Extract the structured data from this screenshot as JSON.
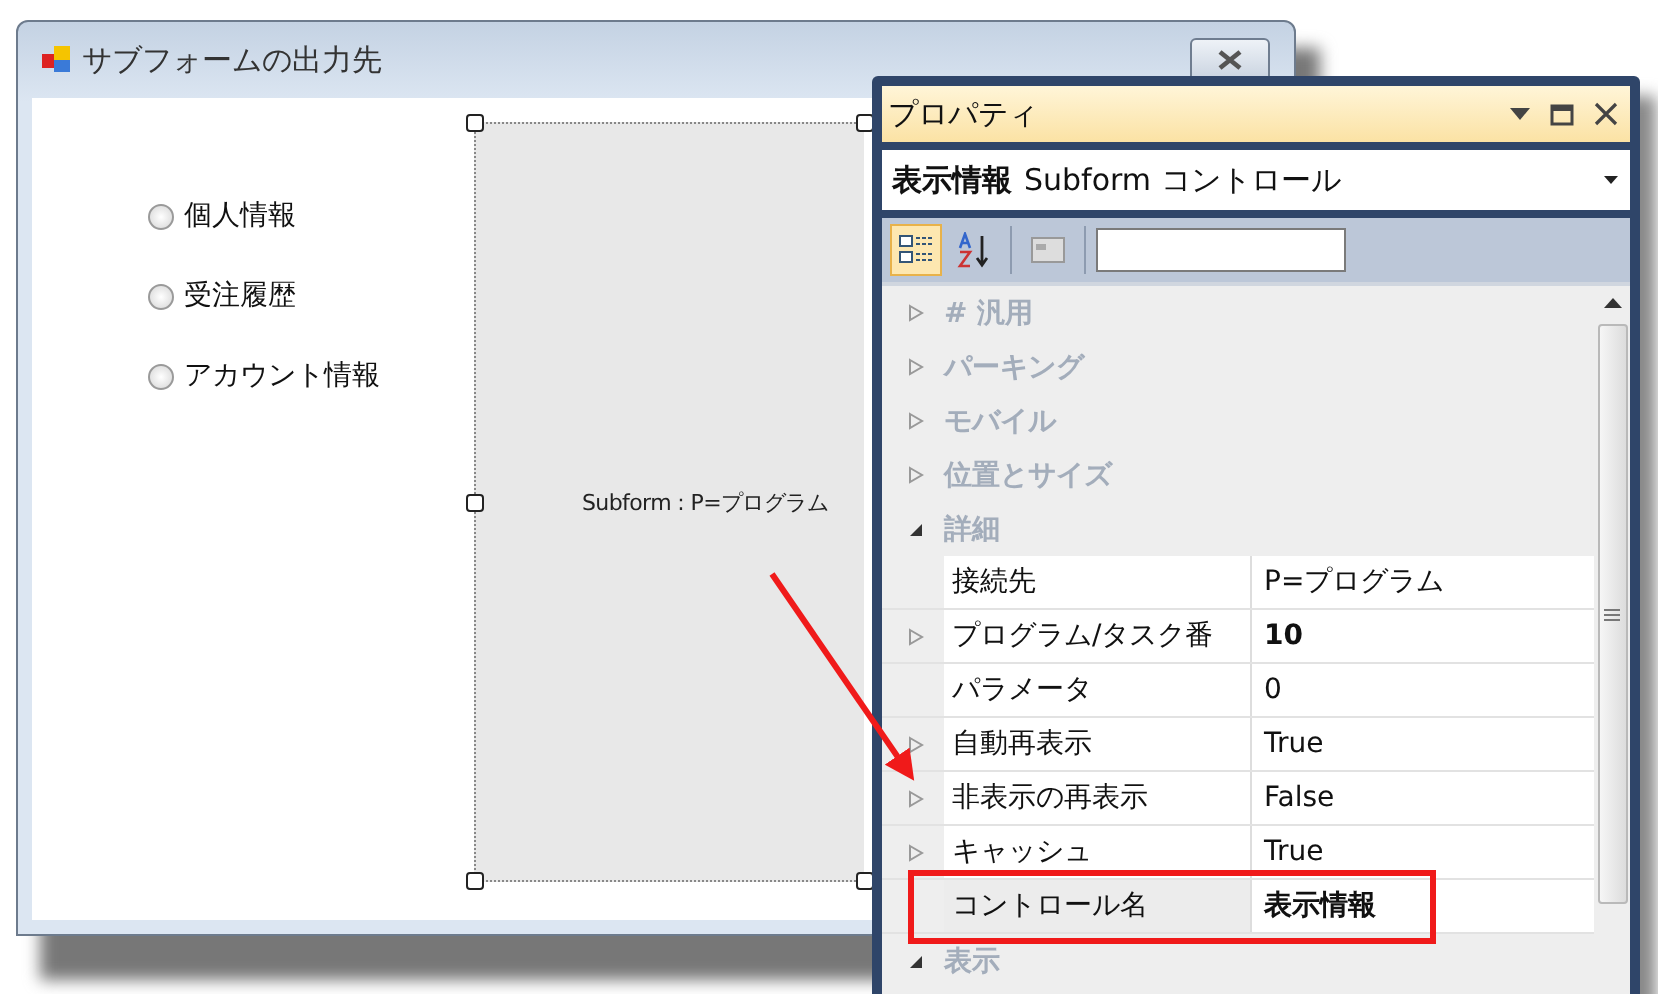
{
  "form_window": {
    "title": "サブフォームの出力先",
    "radios": [
      {
        "label": "個人情報",
        "selected": false
      },
      {
        "label": "受注履歴",
        "selected": false
      },
      {
        "label": "アカウント情報",
        "selected": false
      }
    ],
    "subform": {
      "label": "Subform : P=プログラム"
    }
  },
  "properties_panel": {
    "title": "プロパティ",
    "selector": {
      "name": "表示情報",
      "type": "Subform コントロール"
    },
    "view_buttons": [
      {
        "kind": "categorized",
        "selected": true
      },
      {
        "kind": "alphabetical",
        "selected": false
      },
      {
        "kind": "pages",
        "selected": false
      }
    ],
    "grid": [
      {
        "kind": "category",
        "label": "# 汎用",
        "expanded": false
      },
      {
        "kind": "category",
        "label": "パーキング",
        "expanded": false
      },
      {
        "kind": "category",
        "label": "モバイル",
        "expanded": false
      },
      {
        "kind": "category",
        "label": "位置とサイズ",
        "expanded": false
      },
      {
        "kind": "category",
        "label": "詳細",
        "expanded": true
      },
      {
        "kind": "property",
        "name": "接続先",
        "value": "P=プログラム",
        "expandable": false,
        "modified": false,
        "selected": false,
        "highlighted": false
      },
      {
        "kind": "property",
        "name": "プログラム/タスク番",
        "value": "10",
        "expandable": true,
        "modified": true,
        "selected": false,
        "highlighted": false
      },
      {
        "kind": "property",
        "name": "パラメータ",
        "value": "0",
        "expandable": false,
        "modified": false,
        "selected": false,
        "highlighted": false
      },
      {
        "kind": "property",
        "name": "自動再表示",
        "value": "True",
        "expandable": true,
        "modified": false,
        "selected": false,
        "highlighted": false
      },
      {
        "kind": "property",
        "name": "非表示の再表示",
        "value": "False",
        "expandable": true,
        "modified": false,
        "selected": false,
        "highlighted": false
      },
      {
        "kind": "property",
        "name": "キャッシュ",
        "value": "True",
        "expandable": true,
        "modified": false,
        "selected": false,
        "highlighted": false
      },
      {
        "kind": "property",
        "name": "コントロール名",
        "value": "表示情報",
        "expandable": false,
        "modified": true,
        "selected": true,
        "highlighted": true
      },
      {
        "kind": "category",
        "label": "表示",
        "expanded": true
      }
    ]
  }
}
